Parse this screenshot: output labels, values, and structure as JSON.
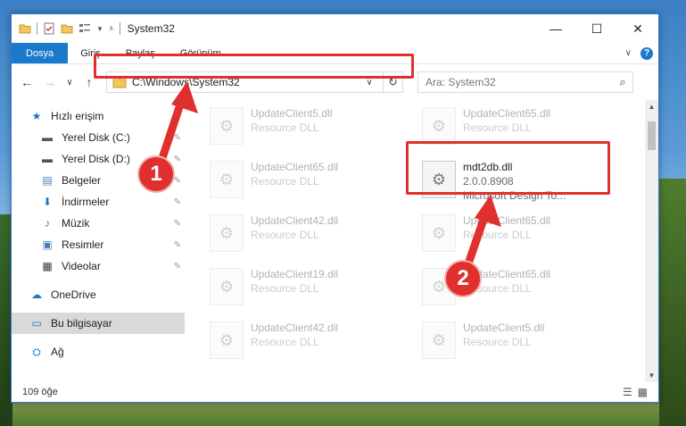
{
  "titlebar": {
    "title": "System32",
    "minimize_glyph": "—",
    "maximize_glyph": "☐",
    "close_glyph": "✕"
  },
  "ribbon": {
    "tabs": [
      "Dosya",
      "Giriş",
      "Paylaş",
      "Görünüm"
    ],
    "help_glyph": "?"
  },
  "nav": {
    "back_glyph": "←",
    "forward_glyph": "→",
    "recent_glyph": "∨",
    "up_glyph": "↑"
  },
  "address": {
    "path": "C:\\Windows\\System32",
    "dropdown_glyph": "∨",
    "refresh_glyph": "↻"
  },
  "search": {
    "placeholder": "Ara: System32",
    "icon_glyph": "⌕"
  },
  "sidebar": {
    "items": [
      {
        "label": "Hızlı erişim",
        "icon": "star-icon",
        "glyph": "★"
      },
      {
        "label": "Yerel Disk (C:)",
        "icon": "drive-icon",
        "glyph": "▬"
      },
      {
        "label": "Yerel Disk (D:)",
        "icon": "drive-icon",
        "glyph": "▬"
      },
      {
        "label": "Belgeler",
        "icon": "documents-icon",
        "glyph": "▤"
      },
      {
        "label": "İndirmeler",
        "icon": "download-icon",
        "glyph": "⬇"
      },
      {
        "label": "Müzik",
        "icon": "music-icon",
        "glyph": "♪"
      },
      {
        "label": "Resimler",
        "icon": "pictures-icon",
        "glyph": "▣"
      },
      {
        "label": "Videolar",
        "icon": "videos-icon",
        "glyph": "▦"
      },
      {
        "label": "OneDrive",
        "icon": "cloud-icon",
        "glyph": "☁"
      },
      {
        "label": "Bu bilgisayar",
        "icon": "computer-icon",
        "glyph": "▭"
      },
      {
        "label": "Ağ",
        "icon": "network-icon",
        "glyph": "⛭"
      }
    ],
    "pin_glyph": "✎"
  },
  "files": [
    {
      "name": "UpdateClient5.dll",
      "sub": "Resource DLL"
    },
    {
      "name": "UpdateClient65.dll",
      "sub": "Resource DLL"
    },
    {
      "name": "UpdateClient65.dll",
      "sub": "Resource DLL"
    },
    {
      "name": "mdt2db.dll",
      "version": "2.0.0.8908",
      "desc": "Microsoft Design To..."
    },
    {
      "name": "UpdateClient42.dll",
      "sub": "Resource DLL"
    },
    {
      "name": "UpdateClient65.dll",
      "sub": "Resource DLL"
    },
    {
      "name": "UpdateClient19.dll",
      "sub": "Resource DLL"
    },
    {
      "name": "UpdateClient65.dll",
      "sub": "Resource DLL"
    },
    {
      "name": "UpdateClient42.dll",
      "sub": "Resource DLL"
    },
    {
      "name": "UpdateClient5.dll",
      "sub": "Resource DLL"
    }
  ],
  "file_icon_glyph": "⚙",
  "scroll": {
    "up_glyph": "▲",
    "down_glyph": "▼"
  },
  "status": {
    "count": "109 öğe",
    "details_glyph": "☰",
    "tiles_glyph": "▦"
  },
  "callouts": [
    {
      "number": "1"
    },
    {
      "number": "2"
    }
  ],
  "colors": {
    "accent": "#1979ca",
    "highlight": "#e0302e"
  }
}
